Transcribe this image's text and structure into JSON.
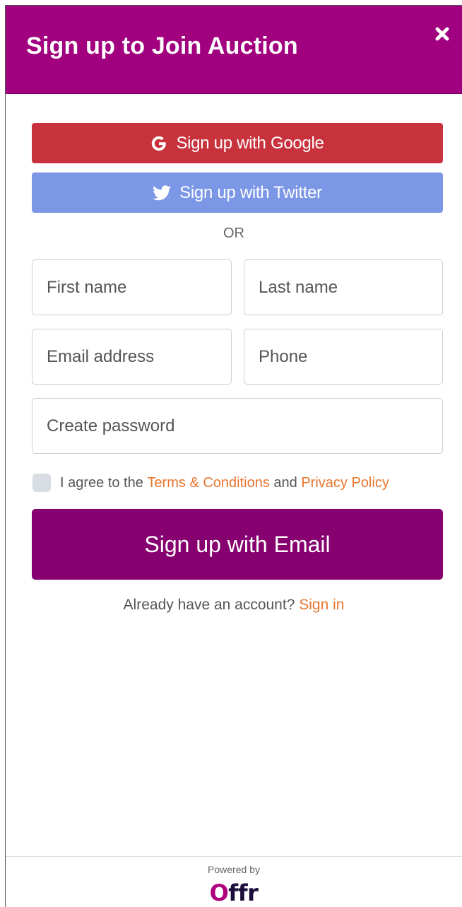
{
  "modal": {
    "title": "Sign up to Join Auction",
    "close_icon": "close-icon"
  },
  "social": {
    "google_label": "Sign up with Google",
    "google_icon": "google-icon",
    "twitter_label": "Sign up with Twitter",
    "twitter_icon": "twitter-icon"
  },
  "divider_text": "OR",
  "form": {
    "first_name_placeholder": "First name",
    "last_name_placeholder": "Last name",
    "email_placeholder": "Email address",
    "phone_placeholder": "Phone",
    "password_placeholder": "Create password",
    "agree_prefix": "I agree to the",
    "terms_link": "Terms & Conditions",
    "agree_and": "and",
    "privacy_link": "Privacy Policy",
    "submit_label": "Sign up with Email"
  },
  "signin": {
    "prompt": "Already have an account?",
    "link": "Sign in"
  },
  "footer": {
    "powered_by": "Powered by",
    "logo_text": "Offr"
  },
  "colors": {
    "header": "#a1007e",
    "google": "#c8323c",
    "twitter": "#7b97e6",
    "submit": "#87006f",
    "link": "#e8762e"
  }
}
